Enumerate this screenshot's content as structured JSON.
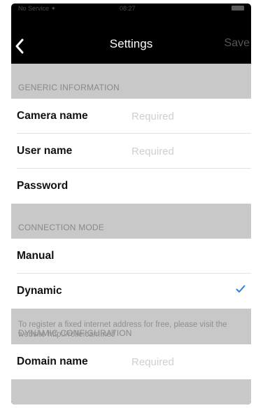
{
  "statusbar": {
    "carrier": "No Service ✦",
    "time": "08:27"
  },
  "navbar": {
    "title": "Settings",
    "save_label": "Save",
    "back_icon": "chevron-left-icon"
  },
  "sections": {
    "generic": {
      "header": "GENERIC INFORMATION",
      "camera_name_label": "Camera name",
      "camera_name_placeholder": "Required",
      "user_name_label": "User name",
      "user_name_placeholder": "Required",
      "password_label": "Password"
    },
    "connection": {
      "header": "CONNECTION MODE",
      "manual_label": "Manual",
      "dynamic_label": "Dynamic",
      "selected": "Dynamic"
    },
    "dynamic_config": {
      "header": "DYNAMIC CONFIGURATION",
      "domain_label": "Domain name",
      "domain_placeholder": "Required"
    }
  },
  "footer_note": "To register a fixed internet address for free, please visit the website http://rolleicam.net/",
  "colors": {
    "accent": "#2f7de1",
    "group_background": "#c8c8c8",
    "navbar": "#000000"
  }
}
